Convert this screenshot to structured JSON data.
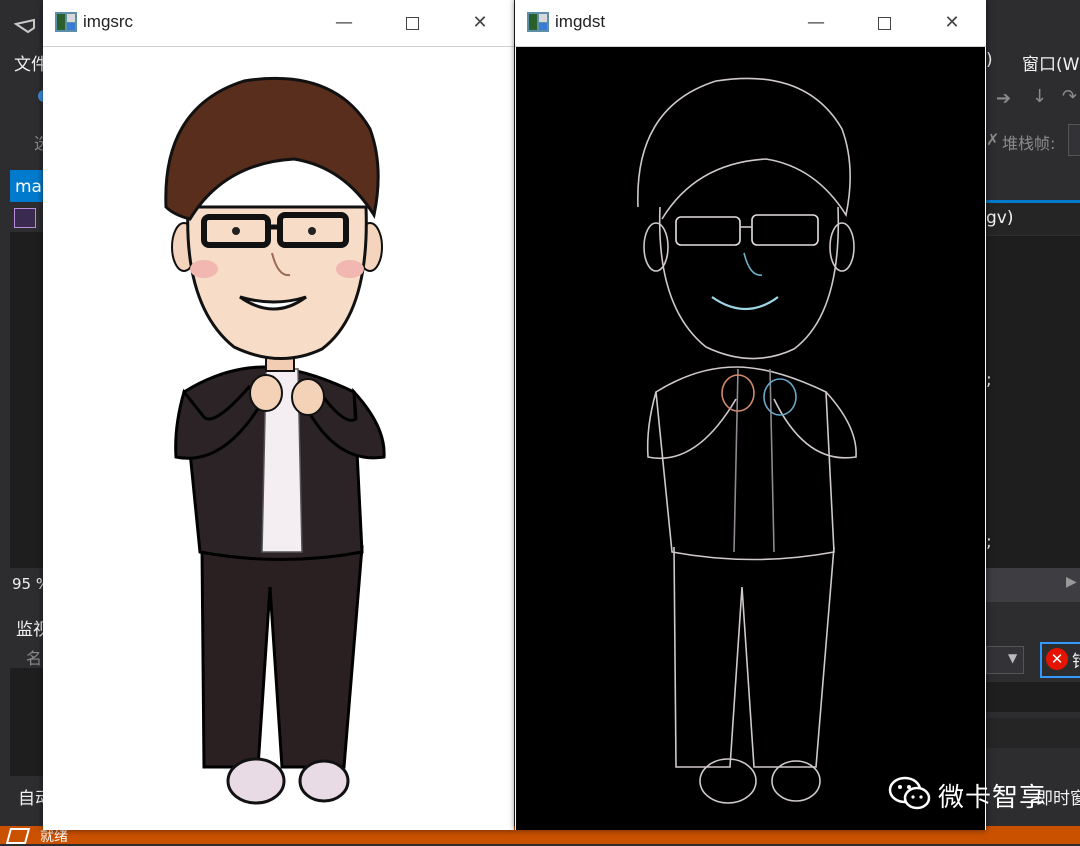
{
  "ide": {
    "menu_left": "文件",
    "menu_paren": ")",
    "menu_window": "窗口(W",
    "tab_label": "ma",
    "stack_frame_label": "堆栈帧:",
    "code_snippet": "gv)",
    "semicolon_1": ";",
    "semicolon_2": ";",
    "zoom_label": "95 %",
    "watch_label": "监视",
    "name_label": "名",
    "auto_label": "自动",
    "error_label": "错",
    "immediate_label": "即时窗",
    "status_text": "就绪",
    "accent_color": "#007acc",
    "status_color": "#ca5100"
  },
  "windows": [
    {
      "title": "imgsrc",
      "minimize_icon": "minimize-icon",
      "maximize_icon": "maximize-icon",
      "close_icon": "close-icon",
      "content": "cartoon-man-in-suit"
    },
    {
      "title": "imgdst",
      "minimize_icon": "minimize-icon",
      "maximize_icon": "maximize-icon",
      "close_icon": "close-icon",
      "content": "edge-detected-cartoon-man"
    }
  ],
  "watermark": {
    "text": "微卡智享",
    "icon": "wechat-icon"
  }
}
